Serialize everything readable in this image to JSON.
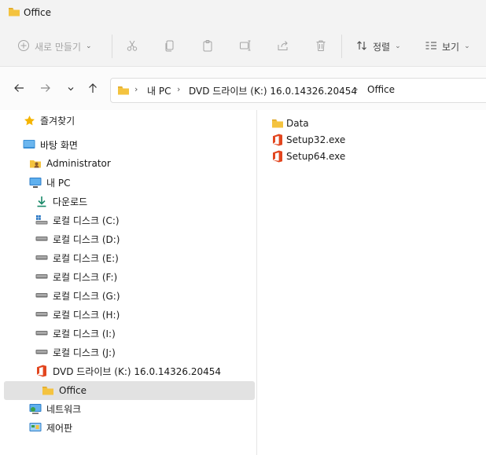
{
  "window": {
    "title": "Office"
  },
  "toolbar": {
    "new_label": "새로 만들기",
    "sort_label": "정렬",
    "view_label": "보기"
  },
  "breadcrumb": {
    "items": [
      "내 PC",
      "DVD 드라이브 (K:) 16.0.14326.20454",
      "Office"
    ],
    "separator": "›"
  },
  "nav": {
    "favorites": "즐겨찾기",
    "desktop": "바탕 화면",
    "administrator": "Administrator",
    "this_pc": "내 PC",
    "downloads": "다운로드",
    "drives": [
      "로컬 디스크 (C:)",
      "로컬 디스크 (D:)",
      "로컬 디스크 (E:)",
      "로컬 디스크 (F:)",
      "로컬 디스크 (G:)",
      "로컬 디스크 (H:)",
      "로컬 디스크 (I:)",
      "로컬 디스크 (J:)"
    ],
    "dvd": "DVD 드라이브 (K:) 16.0.14326.20454",
    "office": "Office",
    "network": "네트워크",
    "control_panel": "제어판"
  },
  "files": [
    {
      "name": "Data",
      "icon": "folder-icon"
    },
    {
      "name": "Setup32.exe",
      "icon": "office-icon"
    },
    {
      "name": "Setup64.exe",
      "icon": "office-icon"
    }
  ],
  "colors": {
    "folder": "#f4c33f",
    "office": "#e2461f",
    "selection": "#e2e2e2",
    "accent_download": "#1c8a6a"
  }
}
